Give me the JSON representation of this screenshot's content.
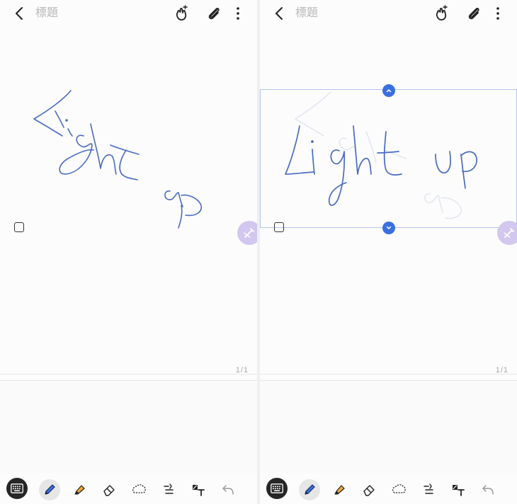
{
  "left": {
    "title": "標題",
    "page_indicator": "1/1"
  },
  "right": {
    "title": "標題",
    "page_indicator": "1/1"
  },
  "icons": {
    "back": "chevron-left-icon",
    "pen_mode": "finger-draw-icon",
    "attach": "paperclip-icon",
    "more": "more-vertical-icon",
    "keyboard": "keyboard-icon",
    "pen": "pen-icon",
    "highlighter": "highlighter-icon",
    "eraser": "eraser-icon",
    "lasso": "lasso-icon",
    "straighten": "straighten-lines-icon",
    "text_convert": "handwriting-to-text-icon",
    "undo": "undo-icon"
  },
  "colors": {
    "ink": "#4a6bc1",
    "selection": "#3b6fe0",
    "fab": "#d2c7ee",
    "highlighter": "#f2a93b"
  }
}
